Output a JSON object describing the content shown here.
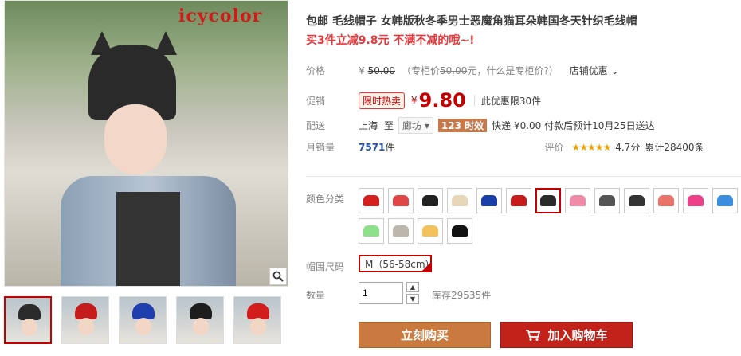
{
  "gallery": {
    "brand": "icycolor",
    "thumbnails": [
      {
        "hat_color": "#2a2a2a"
      },
      {
        "hat_color": "#c41c1c"
      },
      {
        "hat_color": "#1f3fae"
      },
      {
        "hat_color": "#1d1d1d"
      },
      {
        "hat_color": "#d31c1c"
      }
    ]
  },
  "product": {
    "title": "包邮 毛线帽子 女韩版秋冬季男士恶魔角猫耳朵韩国冬天针织毛线帽",
    "promo": "买3件立减9.8元 不满不减的哦~!"
  },
  "price": {
    "label": "价格",
    "currency": "¥",
    "original": "50.00",
    "counter_prefix": "（专柜价",
    "counter_value": "50.00",
    "counter_suffix": " 元，什么是专柜价?）",
    "shop_discount": "店铺优惠"
  },
  "promotion": {
    "label": "促销",
    "tag": "限时热卖",
    "currency": "¥",
    "price": "9.80",
    "limit": "此优惠限30件"
  },
  "delivery": {
    "label": "配送",
    "from": "上海",
    "to_word": "至",
    "destination": "廊坊",
    "badge": "123 时效",
    "shipping": "快递 ¥0.00 付款后预计10月25日送达"
  },
  "sales": {
    "label": "月销量",
    "count": "7571",
    "unit": "件",
    "rating_label": "评价",
    "stars": "★★★★★",
    "score": "4.7分",
    "reviews": "累计28400条"
  },
  "colors": {
    "label": "颜色分类",
    "swatches": [
      {
        "color": "#d62020",
        "selected": false
      },
      {
        "color": "#e04646",
        "selected": false
      },
      {
        "color": "#222222",
        "selected": false
      },
      {
        "color": "#e8d6b8",
        "selected": false
      },
      {
        "color": "#1b3fa8",
        "selected": false
      },
      {
        "color": "#c81c1c",
        "selected": false
      },
      {
        "color": "#2b2b2b",
        "selected": true
      },
      {
        "color": "#f08aa8",
        "selected": false
      },
      {
        "color": "#555555",
        "selected": false
      },
      {
        "color": "#333333",
        "selected": false
      },
      {
        "color": "#e8736a",
        "selected": false
      },
      {
        "color": "#ee3f8a",
        "selected": false
      },
      {
        "color": "#3a8ee0",
        "selected": false
      },
      {
        "color": "#8ee08a",
        "selected": false
      },
      {
        "color": "#bdb6ad",
        "selected": false
      },
      {
        "color": "#f3c25a",
        "selected": false
      },
      {
        "color": "#111111",
        "selected": false
      }
    ]
  },
  "size": {
    "label": "帽围尺码",
    "option": "M（56-58cm）"
  },
  "quantity": {
    "label": "数量",
    "value": "1",
    "stock": "库存29535件"
  },
  "actions": {
    "buy_now": "立刻购买",
    "add_to_cart": "加入购物车"
  }
}
